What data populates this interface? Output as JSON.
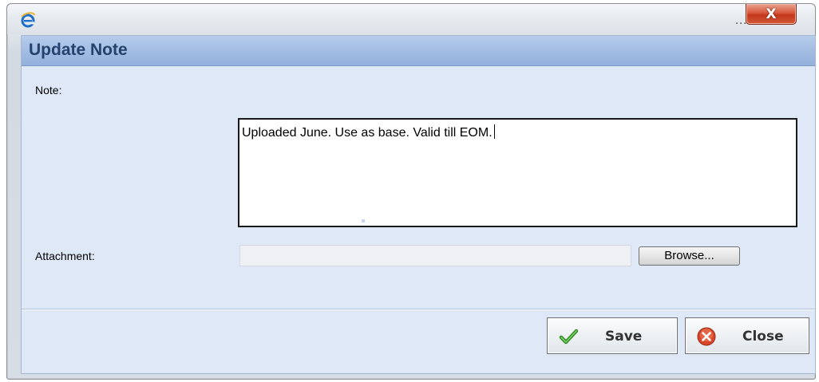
{
  "window": {
    "title_ellipsis": "...",
    "close_glyph": "X",
    "icon": "internet-explorer-icon"
  },
  "dialog": {
    "title": "Update Note",
    "note_label": "Note:",
    "note_value": "Uploaded June. Use as base. Valid till EOM.",
    "attachment_label": "Attachment:",
    "attachment_value": "",
    "browse_label": "Browse..."
  },
  "actions": {
    "save_label": "Save",
    "save_icon": "checkmark-icon",
    "close_label": "Close",
    "close_icon": "close-circle-icon"
  },
  "colors": {
    "header": "#a3bde3",
    "title_text": "#23436e",
    "panel_bg": "#dee8f7",
    "close_red": "#d9573a",
    "save_check": "#3a9b2a"
  }
}
